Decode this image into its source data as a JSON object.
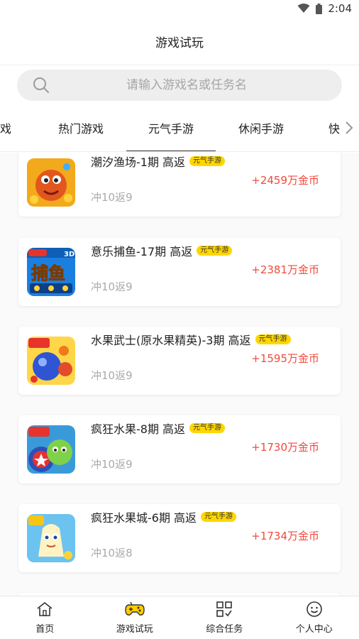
{
  "status_bar": {
    "time": "2:04"
  },
  "header": {
    "title": "游戏试玩"
  },
  "search": {
    "placeholder": "请输入游戏名或任务名"
  },
  "tabs": [
    {
      "label": "戏"
    },
    {
      "label": "热门游戏"
    },
    {
      "label": "元气手游",
      "active": true
    },
    {
      "label": "休闲手游"
    },
    {
      "label": "快"
    }
  ],
  "games": [
    {
      "name": "潮汐渔场-1期 高返",
      "tag": "元气手游",
      "reward": "+2459万金币",
      "sub": "冲10返9",
      "icon": "fish-crab-game-icon"
    },
    {
      "name": "意乐捕鱼-17期 高返",
      "tag": "元气手游",
      "reward": "+2381万金币",
      "sub": "冲10返9",
      "icon": "fishing-3d-game-icon"
    },
    {
      "name": "水果武士(原水果精英)-3期 高返",
      "tag": "元气手游",
      "reward": "+1595万金币",
      "sub": "冲10返9",
      "icon": "fruit-warrior-game-icon"
    },
    {
      "name": "疯狂水果-8期 高返",
      "tag": "元气手游",
      "reward": "+1730万金币",
      "sub": "冲10返9",
      "icon": "crazy-fruit-game-icon"
    },
    {
      "name": "疯狂水果城-6期 高返",
      "tag": "元气手游",
      "reward": "+1734万金币",
      "sub": "冲10返8",
      "icon": "fruit-city-game-icon"
    }
  ],
  "bottom_nav": [
    {
      "label": "首页",
      "icon": "home-icon"
    },
    {
      "label": "游戏试玩",
      "icon": "gamepad-icon",
      "active": true
    },
    {
      "label": "综合任务",
      "icon": "task-grid-icon"
    },
    {
      "label": "个人中心",
      "icon": "smiley-face-icon"
    }
  ],
  "colors": {
    "accent_yellow": "#ffd600",
    "reward_red": "#f04a3d",
    "gamepad_yellow": "#ffcc00"
  }
}
